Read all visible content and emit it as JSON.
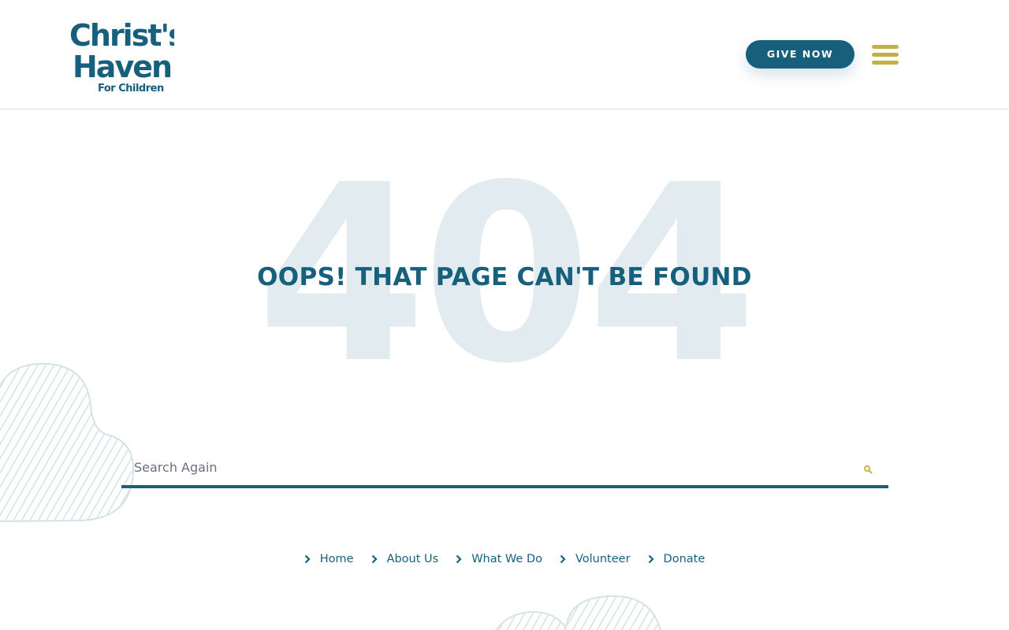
{
  "header": {
    "logo_text": [
      "Christ's",
      "Haven",
      "For Children"
    ],
    "give_button_label": "GIVE NOW",
    "menu_icon": "hamburger-icon"
  },
  "error": {
    "code": "404",
    "title": "OOPS! THAT PAGE CAN'T BE FOUND"
  },
  "search": {
    "placeholder": "Search Again",
    "value": "",
    "icon": "search-icon"
  },
  "footer_nav": {
    "items": [
      {
        "label": "Home"
      },
      {
        "label": "About Us"
      },
      {
        "label": "What We Do"
      },
      {
        "label": "Volunteer"
      },
      {
        "label": "Donate"
      }
    ]
  },
  "colors": {
    "brand_teal": "#17607d",
    "accent_gold": "#c4b146",
    "watermark": "#e2ebef"
  }
}
